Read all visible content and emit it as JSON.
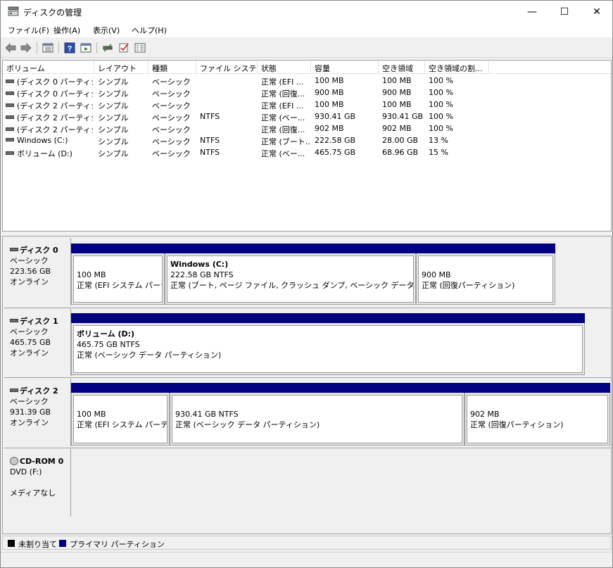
{
  "window": {
    "title": "ディスクの管理",
    "minimize": "—",
    "maximize": "☐",
    "close": "✕"
  },
  "menu": [
    {
      "label": "ファイル(F)"
    },
    {
      "label": "操作(A)"
    },
    {
      "label": "表示(V)"
    },
    {
      "label": "ヘルプ(H)"
    }
  ],
  "toolbar": {
    "icons": [
      "back-icon",
      "forward-icon",
      "disk-list-icon",
      "help-icon",
      "view-icon",
      "connect-icon",
      "check-icon",
      "properties-icon"
    ]
  },
  "volume_table": {
    "columns": [
      "ボリューム",
      "レイアウト",
      "種類",
      "ファイル システム",
      "状態",
      "容量",
      "空き領域",
      "空き領域の割..."
    ],
    "rows": [
      [
        "(ディスク 0 パーティシ...",
        "シンプル",
        "ベーシック",
        "",
        "正常 (EFI ...",
        "100 MB",
        "100 MB",
        "100 %"
      ],
      [
        "(ディスク 0 パーティシ...",
        "シンプル",
        "ベーシック",
        "",
        "正常 (回復...",
        "900 MB",
        "900 MB",
        "100 %"
      ],
      [
        "(ディスク 2 パーティシ...",
        "シンプル",
        "ベーシック",
        "",
        "正常 (EFI ...",
        "100 MB",
        "100 MB",
        "100 %"
      ],
      [
        "(ディスク 2 パーティシ...",
        "シンプル",
        "ベーシック",
        "NTFS",
        "正常 (ベー...",
        "930.41 GB",
        "930.41 GB",
        "100 %"
      ],
      [
        "(ディスク 2 パーティシ...",
        "シンプル",
        "ベーシック",
        "",
        "正常 (回復...",
        "902 MB",
        "902 MB",
        "100 %"
      ],
      [
        "Windows (C:)",
        "シンプル",
        "ベーシック",
        "NTFS",
        "正常 (ブート...",
        "222.58 GB",
        "28.00 GB",
        "13 %"
      ],
      [
        "ボリューム (D:)",
        "シンプル",
        "ベーシック",
        "NTFS",
        "正常 (ベー...",
        "465.75 GB",
        "68.96 GB",
        "15 %"
      ]
    ]
  },
  "disks": [
    {
      "name": "ディスク 0",
      "type": "ベーシック",
      "size": "223.56 GB",
      "status": "オンライン",
      "partitions": [
        {
          "label": "",
          "size": "100 MB",
          "status": "正常 (EFI システム パーテ"
        },
        {
          "label": "Windows  (C:)",
          "size": "222.58 GB NTFS",
          "status": "正常 (ブート, ページ ファイル, クラッシュ ダンプ, ベーシック データ パーティショ"
        },
        {
          "label": "",
          "size": "900 MB",
          "status": "正常 (回復パーティション)"
        }
      ]
    },
    {
      "name": "ディスク 1",
      "type": "ベーシック",
      "size": "465.75 GB",
      "status": "オンライン",
      "partitions": [
        {
          "label": "ボリューム  (D:)",
          "size": "465.75 GB NTFS",
          "status": "正常 (ベーシック データ パーティション)"
        }
      ]
    },
    {
      "name": "ディスク 2",
      "type": "ベーシック",
      "size": "931.39 GB",
      "status": "オンライン",
      "partitions": [
        {
          "label": "",
          "size": "100 MB",
          "status": "正常 (EFI システム パーティ"
        },
        {
          "label": "",
          "size": "930.41 GB NTFS",
          "status": "正常 (ベーシック データ パーティション)"
        },
        {
          "label": "",
          "size": "902 MB",
          "status": "正常 (回復パーティション)"
        }
      ]
    },
    {
      "name": "CD-ROM 0",
      "type": "DVD (F:)",
      "size": "",
      "status": "メディアなし",
      "partitions": []
    }
  ],
  "legend": [
    {
      "label": "未割り当て",
      "color": "#000000"
    },
    {
      "label": "プライマリ パーティション",
      "color": "#000080"
    }
  ]
}
